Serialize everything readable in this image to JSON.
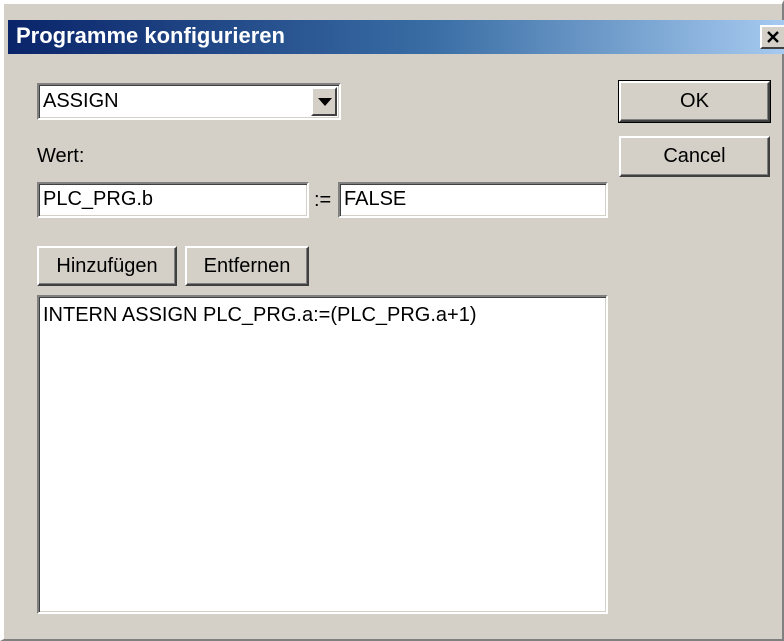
{
  "window": {
    "title": "Programme konfigurieren",
    "close_symbol": "close-icon"
  },
  "mode_select": {
    "selected": "ASSIGN"
  },
  "value_label": "Wert:",
  "variable_input": {
    "value": "PLC_PRG.b"
  },
  "assign_operator": ":=",
  "value_input": {
    "value": "FALSE"
  },
  "buttons": {
    "ok": "OK",
    "cancel": "Cancel",
    "add": "Hinzufügen",
    "remove": "Entfernen"
  },
  "program_list": {
    "items": [
      "INTERN ASSIGN PLC_PRG.a:=(PLC_PRG.a+1)"
    ]
  }
}
